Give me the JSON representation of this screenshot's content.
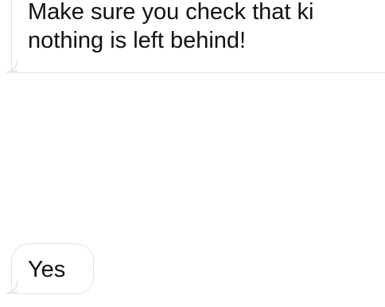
{
  "messages": [
    {
      "direction": "incoming",
      "lines": [
        "Make sure you check that ki",
        "nothing is left behind!"
      ]
    },
    {
      "direction": "incoming",
      "lines": [
        "Yes"
      ]
    }
  ],
  "colors": {
    "background": "#ffffff",
    "bubble_fill": "#ffffff",
    "bubble_border": "#e3e3e6",
    "text": "#111111"
  }
}
